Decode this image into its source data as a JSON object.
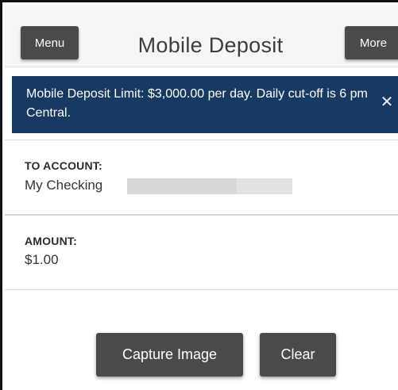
{
  "header": {
    "menu_label": "Menu",
    "title": "Mobile Deposit",
    "more_label": "More"
  },
  "banner": {
    "message": "Mobile Deposit Limit: $3,000.00 per day. Daily cut-off is 6 pm Central.",
    "close_glyph": "✕",
    "background": "#173a63"
  },
  "to_account": {
    "label": "TO ACCOUNT:",
    "value": "My Checking"
  },
  "amount": {
    "label": "AMOUNT:",
    "value": "$1.00"
  },
  "actions": {
    "capture_label": "Capture Image",
    "clear_label": "Clear"
  },
  "colors": {
    "button_bg": "#4a4a4a",
    "header_bg": "#f6f6f6"
  }
}
